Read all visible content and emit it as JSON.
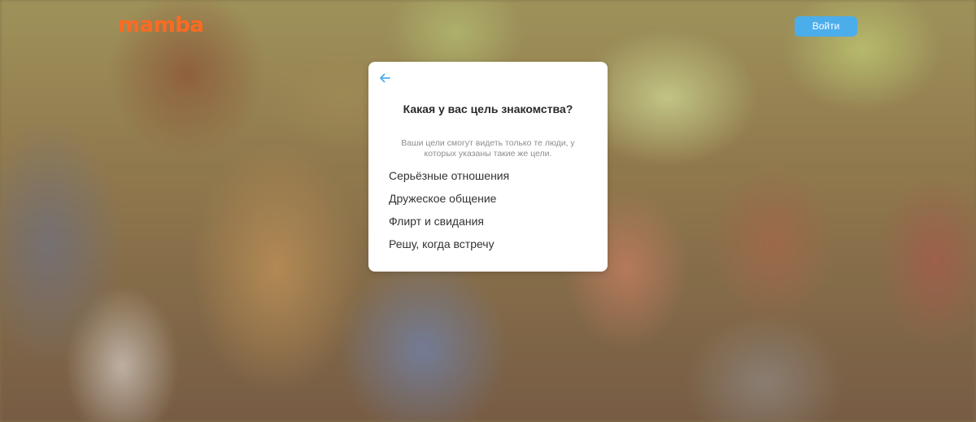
{
  "header": {
    "logo_text": "mamba",
    "login_label": "Войти"
  },
  "modal": {
    "back_icon": "arrow-left-icon",
    "title": "Какая у вас цель знакомства?",
    "subtitle": "Ваши цели смогут видеть только те люди, у которых указаны такие же цели.",
    "options": [
      {
        "label": "Серьёзные отношения"
      },
      {
        "label": "Дружеское общение"
      },
      {
        "label": "Флирт и свидания"
      },
      {
        "label": "Решу, когда встречу"
      }
    ]
  },
  "colors": {
    "brand": "#ff6a22",
    "login_button": "#4cadeb",
    "back_arrow": "#4cadeb"
  }
}
